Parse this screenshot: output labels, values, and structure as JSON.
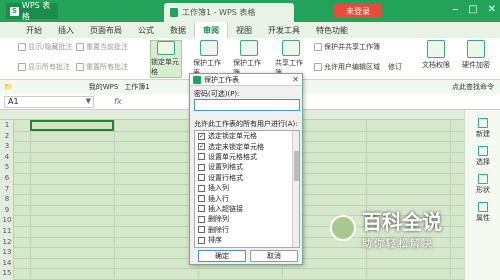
{
  "title_bar": {
    "app_name": "WPS 表格",
    "doc_title": "工作簿1 - WPS 表格",
    "login_label": "未登录",
    "controls": [
      "⎯",
      "□",
      "✕"
    ]
  },
  "menu": {
    "items": [
      "开始",
      "插入",
      "页面布局",
      "公式",
      "数据",
      "审阅",
      "视图",
      "开发工具",
      "特色功能"
    ],
    "active": "审阅"
  },
  "ribbon": {
    "comment_actions": [
      "显示/隐藏批注",
      "显示所有批注",
      "重置当前批注",
      "重置所有批注"
    ],
    "big_buttons": [
      "锁定单元格",
      "保护工作表",
      "保护工作簿",
      "共享工作簿"
    ],
    "right_actions": [
      "保护并共享工作簿",
      "允许用户编辑区域",
      "修订",
      "文档权限",
      "硬件加密"
    ]
  },
  "toolbar2": {
    "items": [
      "我的WPS",
      "工作簿1"
    ],
    "search": "点此查找命令"
  },
  "formula_bar": {
    "cell_ref": "A1",
    "fx": "fx"
  },
  "rows": [
    "1",
    "2",
    "3",
    "4",
    "5",
    "6",
    "7",
    "8",
    "9",
    "10",
    "11",
    "12",
    "13",
    "14",
    "15"
  ],
  "right_panel": {
    "items": [
      "新建",
      "选择",
      "形状",
      "属性"
    ]
  },
  "dialog": {
    "title": "保护工作表",
    "password_label": "密码(可选)(P):",
    "password_value": "",
    "allow_label": "允许此工作表的所有用户进行(A):",
    "options": [
      {
        "label": "选定锁定单元格",
        "checked": true
      },
      {
        "label": "选定未锁定单元格",
        "checked": true
      },
      {
        "label": "设置单元格格式",
        "checked": false
      },
      {
        "label": "设置列格式",
        "checked": false
      },
      {
        "label": "设置行格式",
        "checked": false
      },
      {
        "label": "插入列",
        "checked": false
      },
      {
        "label": "插入行",
        "checked": false
      },
      {
        "label": "插入超链接",
        "checked": false
      },
      {
        "label": "删除列",
        "checked": false
      },
      {
        "label": "删除行",
        "checked": false
      },
      {
        "label": "排序",
        "checked": false
      }
    ],
    "ok_label": "确定",
    "cancel_label": "取消"
  },
  "watermark": {
    "big": "百科全说",
    "small": "助你轻松解决"
  }
}
